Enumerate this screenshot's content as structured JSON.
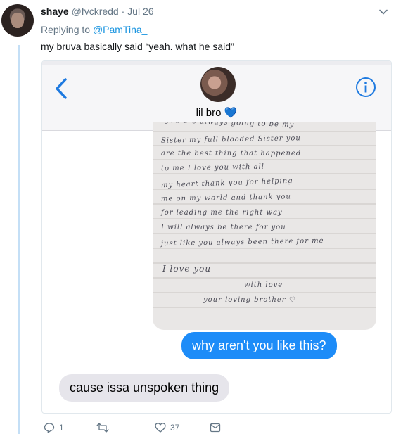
{
  "tweet": {
    "display_name": "shaye",
    "handle": "@fvckredd",
    "separator": "·",
    "date": "Jul 26",
    "replying_prefix": "Replying to ",
    "replying_to": "@PamTina_",
    "text": "my bruva basically said “yeah. what he said”"
  },
  "screenshot": {
    "contact_name": "lil bro",
    "contact_emoji": "💙",
    "letter_lines": [
      "you are always going to be my",
      "Sister my full blooded Sister you",
      "are the best thing that happened",
      "to me I love you with all",
      "my heart thank you for helping",
      "me on my world and thank you",
      "for leading me the right way",
      "I will always be there for you",
      "just like you always been there for me",
      "I love you",
      "with love",
      "your loving brother ♡"
    ],
    "sent_message": "why aren't you like this?",
    "received_message": "cause issa unspoken thing"
  },
  "actions": {
    "reply_count": "1",
    "retweet_count": "",
    "like_count": "37"
  },
  "colors": {
    "accent": "#1b95e0",
    "thread_line": "#c4dff6",
    "imessage_blue": "#1d8cf8",
    "imessage_gray": "#e6e5eb"
  }
}
